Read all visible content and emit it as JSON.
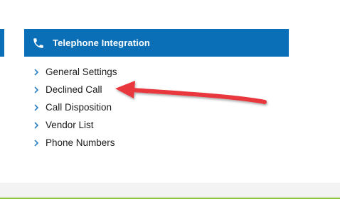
{
  "panel": {
    "title": "Telephone Integration",
    "icon": "phone-icon",
    "header_color": "#0a6fb6"
  },
  "links": [
    {
      "label": "General Settings",
      "icon": "chevron-right-icon"
    },
    {
      "label": "Declined Call",
      "icon": "chevron-right-icon"
    },
    {
      "label": "Call Disposition",
      "icon": "chevron-right-icon"
    },
    {
      "label": "Vendor List",
      "icon": "chevron-right-icon"
    },
    {
      "label": "Phone Numbers",
      "icon": "chevron-right-icon"
    }
  ],
  "annotation": {
    "icon": "red-arrow-icon",
    "color": "#e8383d"
  },
  "footer": {
    "line_color": "#8dc53e"
  }
}
